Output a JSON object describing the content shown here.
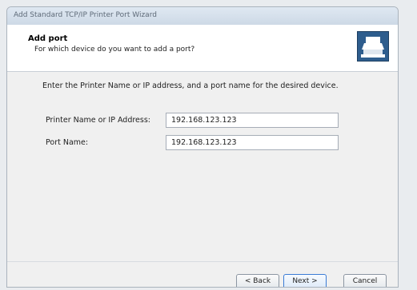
{
  "window": {
    "title": "Add Standard TCP/IP Printer Port Wizard"
  },
  "header": {
    "title": "Add port",
    "subtitle": "For which device do you want to add a port?",
    "icon": "printer-network-icon"
  },
  "body": {
    "instructions": "Enter the Printer Name or IP address, and a port name for the desired device.",
    "printer_label": "Printer Name or IP Address:",
    "printer_value": "192.168.123.123",
    "port_label": "Port Name:",
    "port_value": "192.168.123.123"
  },
  "buttons": {
    "back": "< Back",
    "next": "Next >",
    "cancel": "Cancel"
  },
  "colors": {
    "accent": "#3a7bd5",
    "icon_blue": "#2e5d8d"
  }
}
